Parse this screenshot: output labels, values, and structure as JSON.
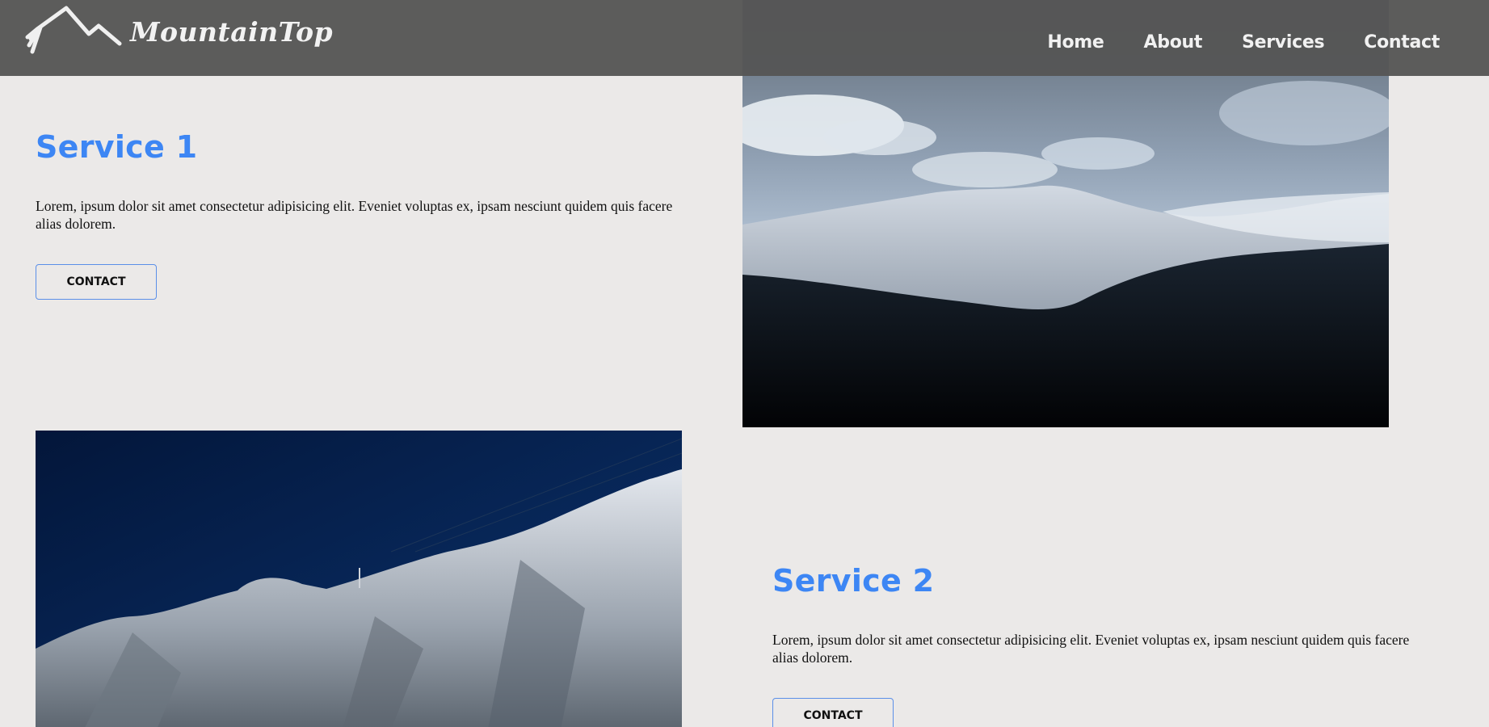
{
  "header": {
    "logo_text": "MountainTop",
    "nav": [
      "Home",
      "About",
      "Services",
      "Contact"
    ]
  },
  "services": [
    {
      "title": "Service 1",
      "text": "Lorem, ipsum dolor sit amet consectetur adipisicing elit. Eveniet voluptas ex, ipsam nesciunt quidem quis facere alias dolorem.",
      "button": "CONTACT"
    },
    {
      "title": "Service 2",
      "text": "Lorem, ipsum dolor sit amet consectetur adipisicing elit. Eveniet voluptas ex, ipsam nesciunt quidem quis facere alias dolorem.",
      "button": "CONTACT"
    }
  ],
  "colors": {
    "accent": "#3d86f4",
    "header_bg": "#555555",
    "page_bg": "#ebe9e8"
  }
}
